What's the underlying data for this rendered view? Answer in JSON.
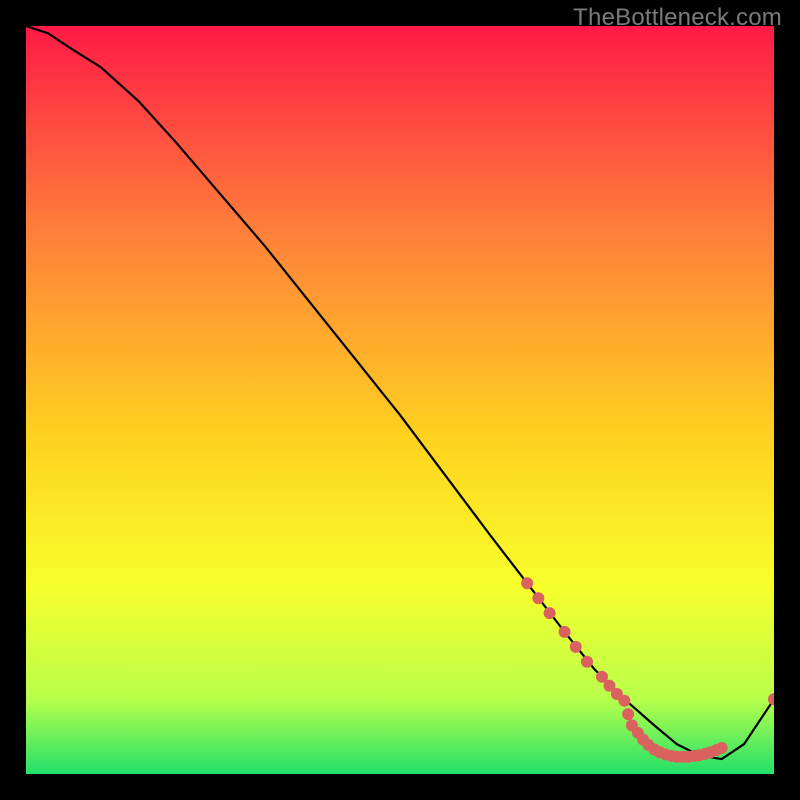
{
  "watermark": "TheBottleneck.com",
  "colors": {
    "bg_black": "#000000",
    "grad_top": "#ff1a46",
    "grad_mid_upper": "#ff813a",
    "grad_mid": "#ffd21f",
    "grad_mid_lower": "#f7ff2b",
    "grad_lower": "#b8ff4a",
    "grad_bottom": "#22e06a",
    "curve": "#000000",
    "dots": "#d9625e",
    "watermark": "#7a7a7a"
  },
  "chart_data": {
    "type": "line",
    "title": "",
    "xlabel": "",
    "ylabel": "",
    "xlim": [
      0,
      100
    ],
    "ylim": [
      0,
      100
    ],
    "curve": {
      "x": [
        0,
        3,
        6,
        10,
        15,
        20,
        26,
        32,
        38,
        44,
        50,
        56,
        62,
        67,
        72,
        76,
        80,
        84,
        87,
        90,
        93,
        96,
        100
      ],
      "y": [
        100,
        99,
        97,
        94.5,
        90,
        84.5,
        77.5,
        70.5,
        63,
        55.5,
        48,
        40,
        32,
        25.5,
        19,
        14,
        10,
        6.5,
        4,
        2.5,
        2,
        4,
        10
      ]
    },
    "dots": [
      {
        "x": 67,
        "y": 25.5
      },
      {
        "x": 68.5,
        "y": 23.5
      },
      {
        "x": 70,
        "y": 21.5
      },
      {
        "x": 72,
        "y": 19
      },
      {
        "x": 73.5,
        "y": 17
      },
      {
        "x": 75,
        "y": 15
      },
      {
        "x": 77,
        "y": 13
      },
      {
        "x": 78,
        "y": 11.8
      },
      {
        "x": 79,
        "y": 10.7
      },
      {
        "x": 80,
        "y": 9.8
      },
      {
        "x": 80.5,
        "y": 8
      },
      {
        "x": 81,
        "y": 6.5
      },
      {
        "x": 81.8,
        "y": 5.5
      },
      {
        "x": 82.5,
        "y": 4.6
      },
      {
        "x": 83.2,
        "y": 3.9
      },
      {
        "x": 84,
        "y": 3.3
      },
      {
        "x": 84.7,
        "y": 2.9
      },
      {
        "x": 85.5,
        "y": 2.6
      },
      {
        "x": 86.3,
        "y": 2.4
      },
      {
        "x": 87,
        "y": 2.3
      },
      {
        "x": 87.8,
        "y": 2.3
      },
      {
        "x": 88.5,
        "y": 2.3
      },
      {
        "x": 89.3,
        "y": 2.4
      },
      {
        "x": 90,
        "y": 2.5
      },
      {
        "x": 90.8,
        "y": 2.7
      },
      {
        "x": 91.5,
        "y": 2.9
      },
      {
        "x": 92.3,
        "y": 3.2
      },
      {
        "x": 93,
        "y": 3.5
      },
      {
        "x": 100,
        "y": 10
      }
    ]
  }
}
